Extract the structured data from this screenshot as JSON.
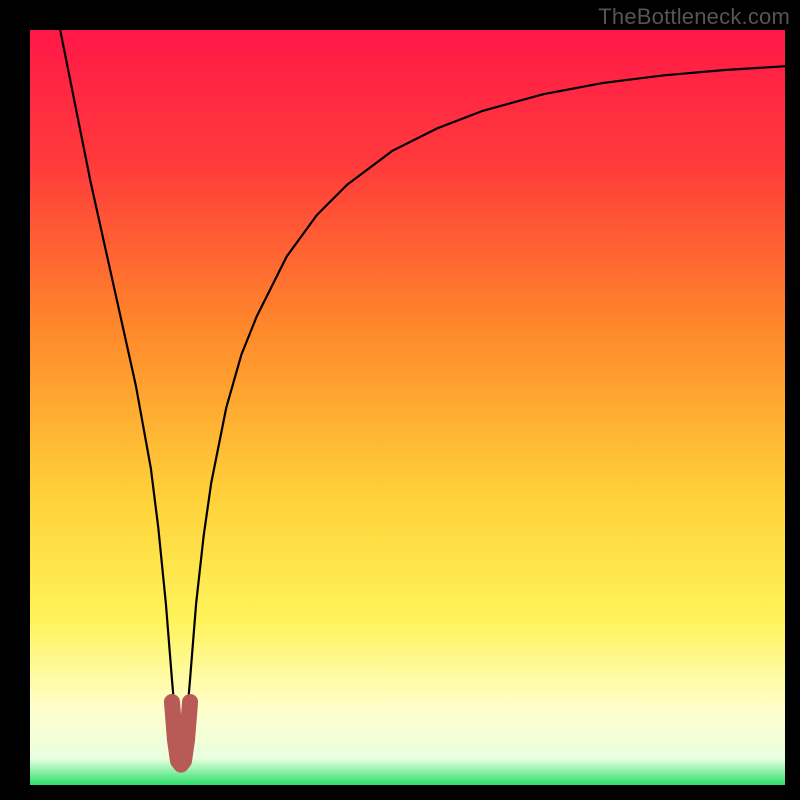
{
  "watermark": "TheBottleneck.com",
  "chart_data": {
    "type": "line",
    "title": "",
    "xlabel": "",
    "ylabel": "",
    "xrange": [
      0,
      100
    ],
    "yrange": [
      0,
      100
    ],
    "gradient_stops": [
      {
        "offset": 0,
        "color": "#ff1847"
      },
      {
        "offset": 0.18,
        "color": "#ff3b3b"
      },
      {
        "offset": 0.4,
        "color": "#ff8a2a"
      },
      {
        "offset": 0.62,
        "color": "#ffd23a"
      },
      {
        "offset": 0.78,
        "color": "#fff35a"
      },
      {
        "offset": 0.9,
        "color": "#ffffcc"
      },
      {
        "offset": 0.965,
        "color": "#e9ffe0"
      },
      {
        "offset": 1.0,
        "color": "#2bdf6a"
      }
    ],
    "curve_min_x": 20,
    "series": [
      {
        "name": "bottleneck-curve",
        "x": [
          4,
          6,
          8,
          10,
          12,
          14,
          16,
          17,
          18,
          18.8,
          19.4,
          20,
          20.6,
          21.2,
          22,
          23,
          24,
          26,
          28,
          30,
          34,
          38,
          42,
          48,
          54,
          60,
          68,
          76,
          84,
          92,
          100
        ],
        "y": [
          100,
          90,
          80,
          71,
          62,
          53,
          42,
          34,
          24,
          14,
          7,
          3,
          7,
          14,
          24,
          33,
          40,
          50,
          57,
          62,
          70,
          75.5,
          79.5,
          84,
          87,
          89.3,
          91.5,
          93,
          94,
          94.7,
          95.2
        ]
      },
      {
        "name": "highlight-dip",
        "x": [
          18.8,
          19.2,
          19.6,
          20,
          20.4,
          20.8,
          21.2
        ],
        "y": [
          11,
          6,
          3.2,
          2.7,
          3.2,
          6,
          11
        ]
      }
    ]
  }
}
